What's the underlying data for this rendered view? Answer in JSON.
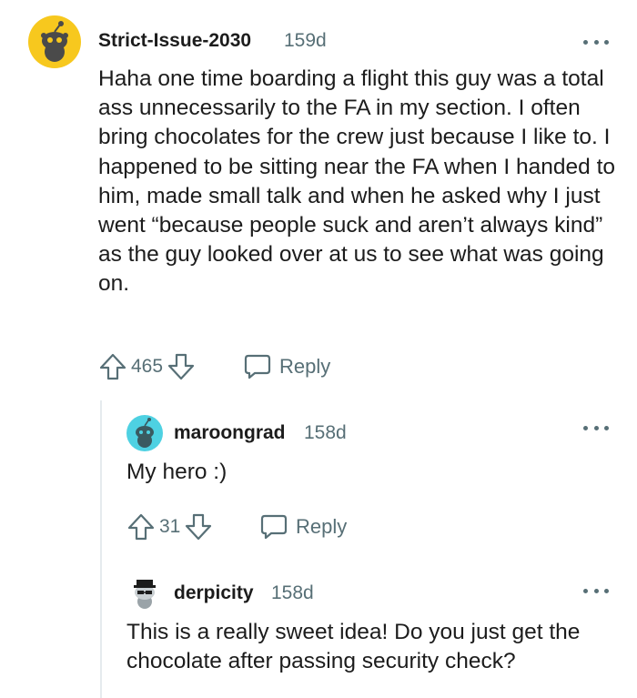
{
  "comments": [
    {
      "username": "Strict-Issue-2030",
      "age": "159d",
      "body": "Haha one time boarding a flight this guy was a total ass unnecessarily to the FA in my section. I often bring chocolates for the crew just because I like to. I happened to be sitting near the FA when I handed to him, made small talk and when he asked why I just went “because people suck and aren’t always kind” as the guy looked over at us to see what was going on.",
      "votes": "465",
      "reply_label": "Reply"
    },
    {
      "username": "maroongrad",
      "age": "158d",
      "body": "My hero :)",
      "votes": "31",
      "reply_label": "Reply"
    },
    {
      "username": "derpicity",
      "age": "158d",
      "body": "This is a really sweet idea! Do you just get the chocolate after passing security check?"
    }
  ],
  "icons": {
    "upvote": "upvote-arrow-icon",
    "downvote": "downvote-arrow-icon",
    "reply": "speech-bubble-icon",
    "more": "more-dots-icon"
  },
  "colors": {
    "text": "#1c1c1c",
    "meta": "#576f76",
    "avatar1_bg": "#f7c81e",
    "avatar2_bg": "#4ed1e2",
    "thread_line": "#e5ebee"
  }
}
